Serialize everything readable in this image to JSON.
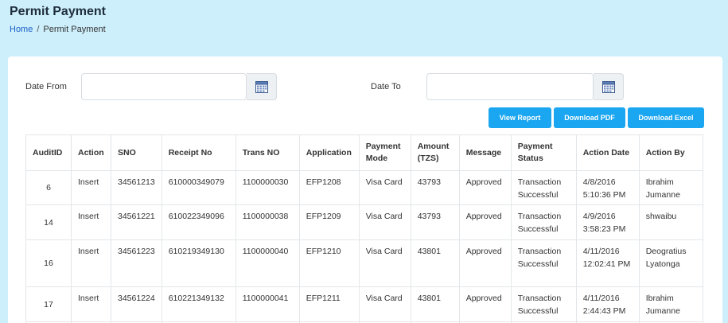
{
  "header": {
    "title": "Permit Payment",
    "breadcrumb": {
      "home": "Home",
      "separator": "/",
      "current": "Permit Payment"
    }
  },
  "filters": {
    "date_from_label": "Date From",
    "date_from_value": "",
    "date_to_label": "Date To",
    "date_to_value": ""
  },
  "buttons": {
    "view_report": "View Report",
    "download_pdf": "Download PDF",
    "download_excel": "Download Excel"
  },
  "table": {
    "columns": [
      "AuditID",
      "Action",
      "SNO",
      "Receipt No",
      "Trans NO",
      "Application",
      "Payment Mode",
      "Amount (TZS)",
      "Message",
      "Payment Status",
      "Action Date",
      "Action By"
    ],
    "rows": [
      [
        "6",
        "Insert",
        "34561213",
        "610000349079",
        "1100000030",
        "EFP1208",
        "Visa Card",
        "43793",
        "Approved",
        "Transaction Successful",
        "4/8/2016 5:10:36 PM",
        "Ibrahim Jumanne"
      ],
      [
        "14",
        "Insert",
        "34561221",
        "610022349096",
        "1100000038",
        "EFP1209",
        "Visa Card",
        "43793",
        "Approved",
        "Transaction Successful",
        "4/9/2016 3:58:23 PM",
        "shwaibu"
      ],
      [
        "16",
        "Insert",
        "34561223",
        "610219349130",
        "1100000040",
        "EFP1210",
        "Visa Card",
        "43801",
        "Approved",
        "Transaction Successful",
        "4/11/2016 12:02:41 PM",
        "Deogratius Lyatonga"
      ],
      [
        "17",
        "Insert",
        "34561224",
        "610221349132",
        "1100000041",
        "EFP1211",
        "Visa Card",
        "43801",
        "Approved",
        "Transaction Successful",
        "4/11/2016 2:44:43 PM",
        "Ibrahim Jumanne"
      ]
    ]
  },
  "colors": {
    "background": "#cdeffb",
    "accent": "#1aa6f0",
    "link": "#1a5fc7"
  },
  "icons": {
    "calendar": "calendar-icon"
  }
}
